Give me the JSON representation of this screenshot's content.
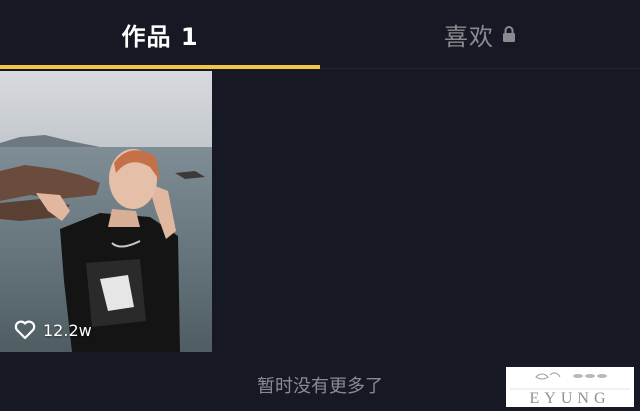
{
  "tabs": {
    "works_label": "作品 1",
    "likes_label": "喜欢",
    "active": "works",
    "accent": "#f3c544"
  },
  "icons": {
    "lock": "lock-icon",
    "heart": "heart-icon"
  },
  "videos": [
    {
      "like_count": "12.2w"
    }
  ],
  "footer": {
    "no_more_text": "暂时没有更多了"
  },
  "watermark": {
    "text": "EYUNG"
  },
  "colors": {
    "background": "#161823",
    "active_text": "#ffffff",
    "inactive_text": "#8a8b91"
  }
}
